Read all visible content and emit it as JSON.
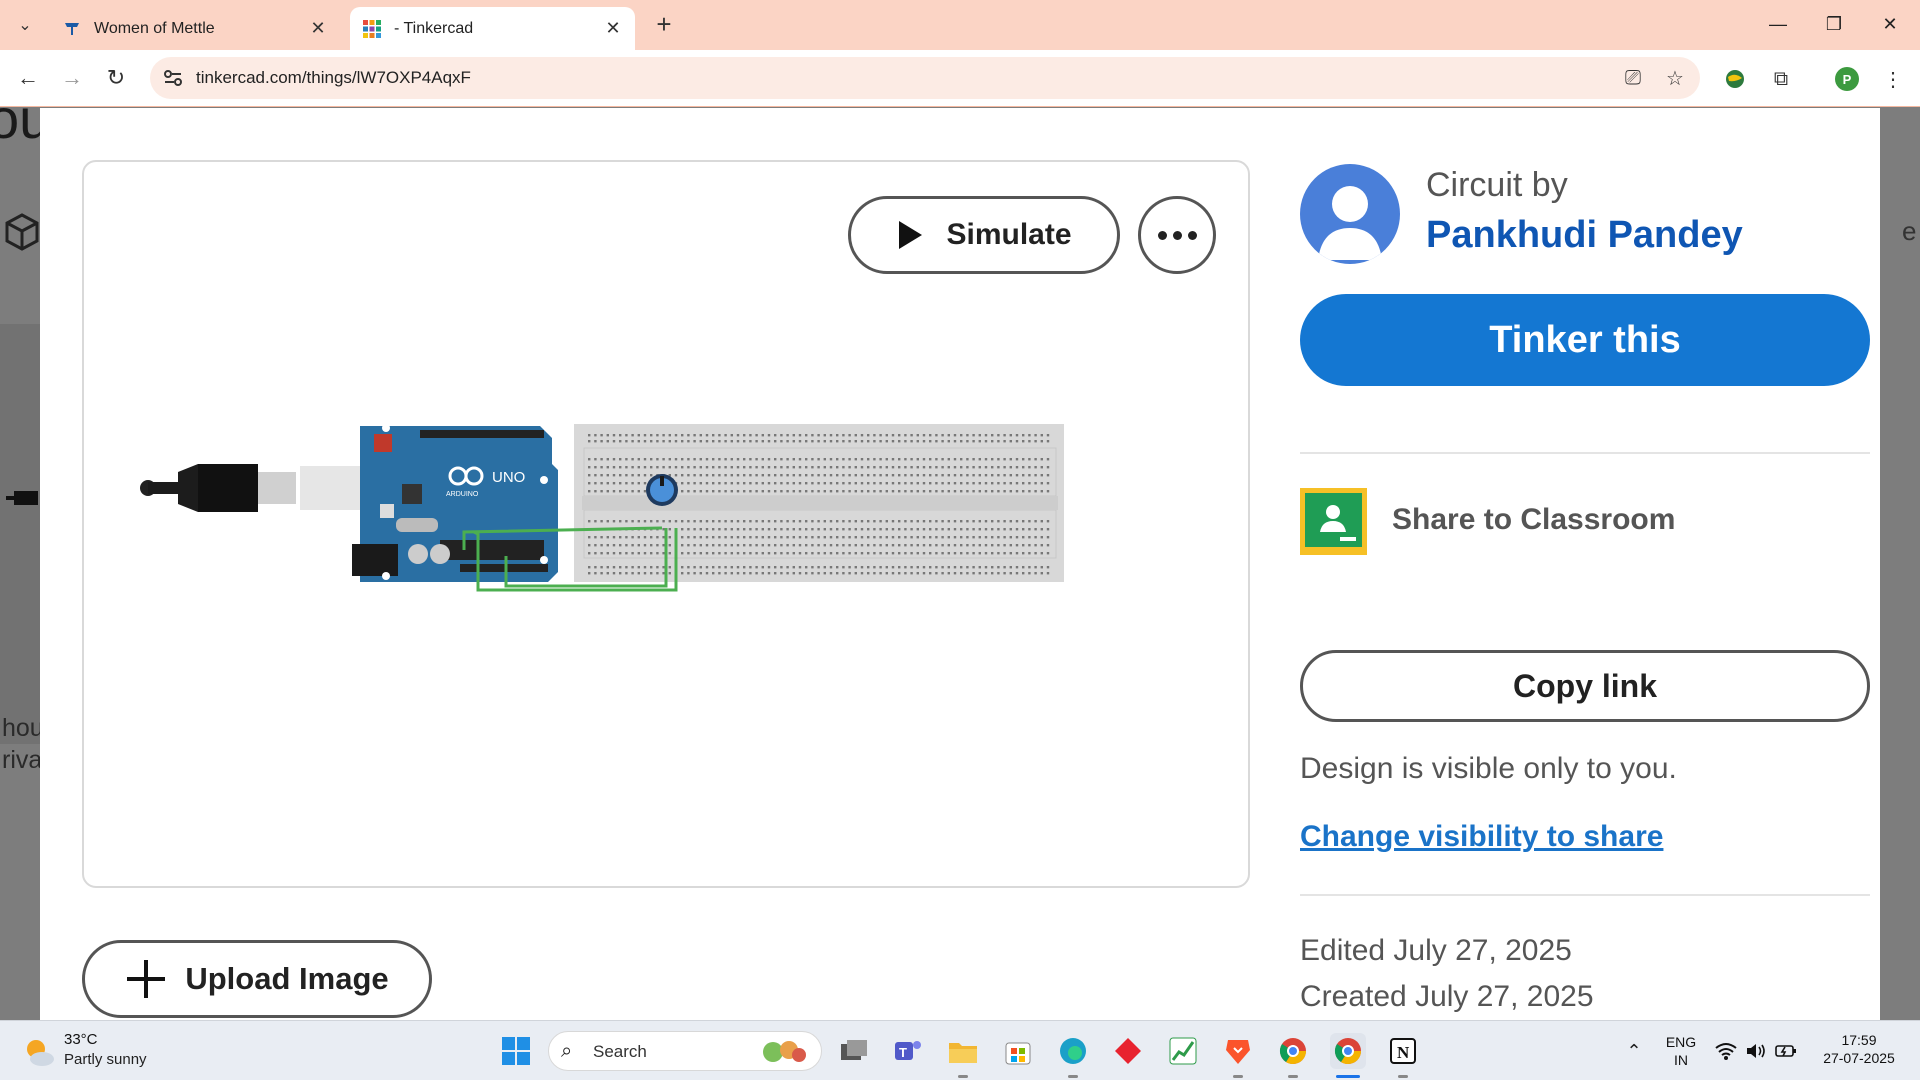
{
  "browser": {
    "tabs": [
      {
        "title": "Women of Mettle",
        "favicon": "tata-logo-icon",
        "active": false
      },
      {
        "title": "- Tinkercad",
        "favicon": "tinkercad-grid-icon",
        "active": true
      }
    ],
    "url": "tinkercad.com/things/lW7OXP4AqxF",
    "profile_initial": "P"
  },
  "background_page": {
    "heading_fragment": "ou",
    "text_line1": "hou",
    "text_line2": "riva",
    "right_fragment": "e"
  },
  "modal": {
    "simulate_label": "Simulate",
    "upload_label": "Upload Image",
    "circuit_by": "Circuit by",
    "author": "Pankhudi Pandey",
    "tinker_label": "Tinker this",
    "share_classroom": "Share to Classroom",
    "copy_link": "Copy link",
    "visibility_note": "Design is visible only to you.",
    "change_visibility": "Change visibility to share",
    "edited": "Edited July 27, 2025",
    "created": "Created July 27, 2025",
    "board_label": "UNO",
    "board_brand": "ARDUINO"
  },
  "colors": {
    "tabbar": "#fbd4c5",
    "primary": "#1477d2",
    "author": "#0f56b3",
    "link": "#1a73c8"
  },
  "taskbar": {
    "weather_temp": "33°C",
    "weather_desc": "Partly sunny",
    "search_placeholder": "Search",
    "lang_line1": "ENG",
    "lang_line2": "IN",
    "time": "17:59",
    "date": "27-07-2025"
  }
}
